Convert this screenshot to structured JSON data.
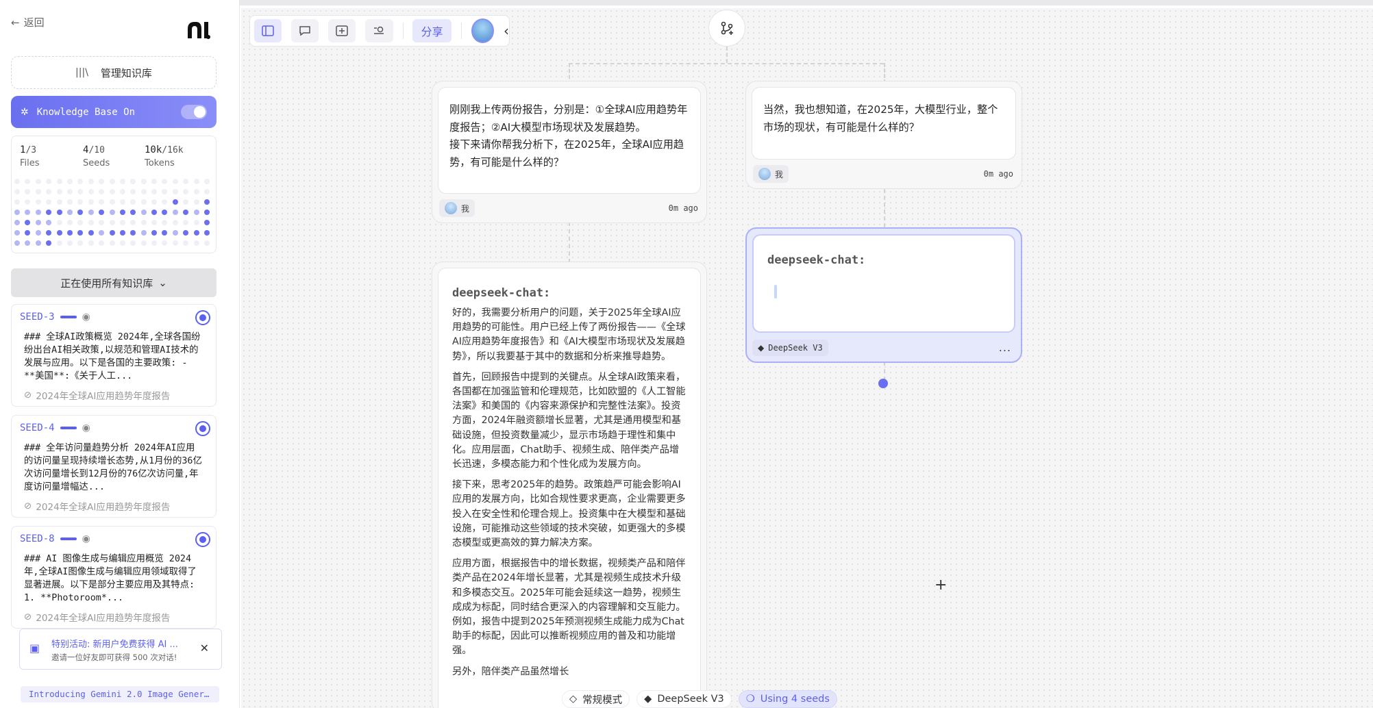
{
  "sidebar": {
    "back_label": "返回",
    "manage_label": "管理知识库",
    "kb_toggle_label": "Knowledge Base On",
    "stats": [
      {
        "value": "1",
        "total": "/3",
        "label": "Files"
      },
      {
        "value": "4",
        "total": "/10",
        "label": "Seeds"
      },
      {
        "value": "10k",
        "total": "/16k",
        "label": "Tokens"
      }
    ],
    "using_label": "正在使用所有知识库",
    "seeds": [
      {
        "id": "SEED-3",
        "text": "### 全球AI政策概览 2024年,全球各国纷纷出台AI相关政策,以规范和管理AI技术的发展与应用。以下是各国的主要政策: - **美国**:《关于人工...",
        "source": "2024年全球AI应用趋势年度报告"
      },
      {
        "id": "SEED-4",
        "text": "### 全年访问量趋势分析 2024年AI应用的访问量呈现持续增长态势,从1月份的36亿次访问量增长到12月份的76亿次访问量,年度访问量增幅达...",
        "source": "2024年全球AI应用趋势年度报告"
      },
      {
        "id": "SEED-8",
        "text": "### AI 图像生成与编辑应用概览 2024年,全球AI图像生成与编辑应用领域取得了显著进展。以下是部分主要应用及其特点: 1. **Photoroom*...",
        "source": "2024年全球AI应用趋势年度报告"
      }
    ],
    "promo": {
      "title": "特别活动: 新用户免费获得 AI ...",
      "subtitle": "邀请一位好友即可获得 500 次对话!"
    },
    "intro_link": "Introducing Gemini 2.0 Image Gener..."
  },
  "toolbar": {
    "share_label": "分享"
  },
  "nodes": {
    "user1": {
      "text": "刚刚我上传两份报告，分别是：①全球AI应用趋势年度报告；②AI大模型市场现状及发展趋势。\n接下来请你帮我分析下，在2025年，全球AI应用趋势，有可能是什么样的？",
      "author": "我",
      "time": "0m ago"
    },
    "user2": {
      "text": "当然，我也想知道，在2025年，大模型行业，整个市场的现状，有可能是什么样的？",
      "author": "我",
      "time": "0m ago"
    },
    "ai1": {
      "title": "deepseek-chat:",
      "paragraphs": [
        "好的，我需要分析用户的问题，关于2025年全球AI应用趋势的可能性。用户已经上传了两份报告——《全球AI应用趋势年度报告》和《AI大模型市场现状及发展趋势》，所以我要基于其中的数据和分析来推导趋势。",
        "首先，回顾报告中提到的关键点。从全球AI政策来看，各国都在加强监管和伦理规范，比如欧盟的《人工智能法案》和美国的《内容来源保护和完整性法案》。投资方面，2024年融资额增长显著，尤其是通用模型和基础设施，但投资数量减少，显示市场趋于理性和集中化。应用层面，Chat助手、视频生成、陪伴类产品增长迅速，多模态能力和个性化成为发展方向。",
        "接下来，思考2025年的趋势。政策趋严可能会影响AI应用的发展方向，比如合规性要求更高，企业需要更多投入在安全性和伦理合规上。投资集中在大模型和基础设施，可能推动这些领域的技术突破，如更强大的多模态模型或更高效的算力解决方案。",
        "应用方面，根据报告中的增长数据，视频类产品和陪伴类产品在2024年增长显著，尤其是视频生成技术升级和多模态交互。2025年可能会延续这一趋势，视频生成成为标配，同时结合更深入的内容理解和交互能力。例如，报告中提到2025年预测视频生成能力成为Chat助手的标配，因此可以推断视频应用的普及和功能增强。",
        "另外，陪伴类产品虽然增长"
      ]
    },
    "ai2": {
      "title": "deepseek-chat:",
      "model": "DeepSeek V3",
      "more": "..."
    }
  },
  "bottom_bar": {
    "mode_label": "常规模式",
    "model_label": "DeepSeek V3",
    "seeds_label": "Using 4 seeds"
  },
  "colors": {
    "accent": "#5b5ff0",
    "canvas_bg": "#f6f5f6"
  }
}
